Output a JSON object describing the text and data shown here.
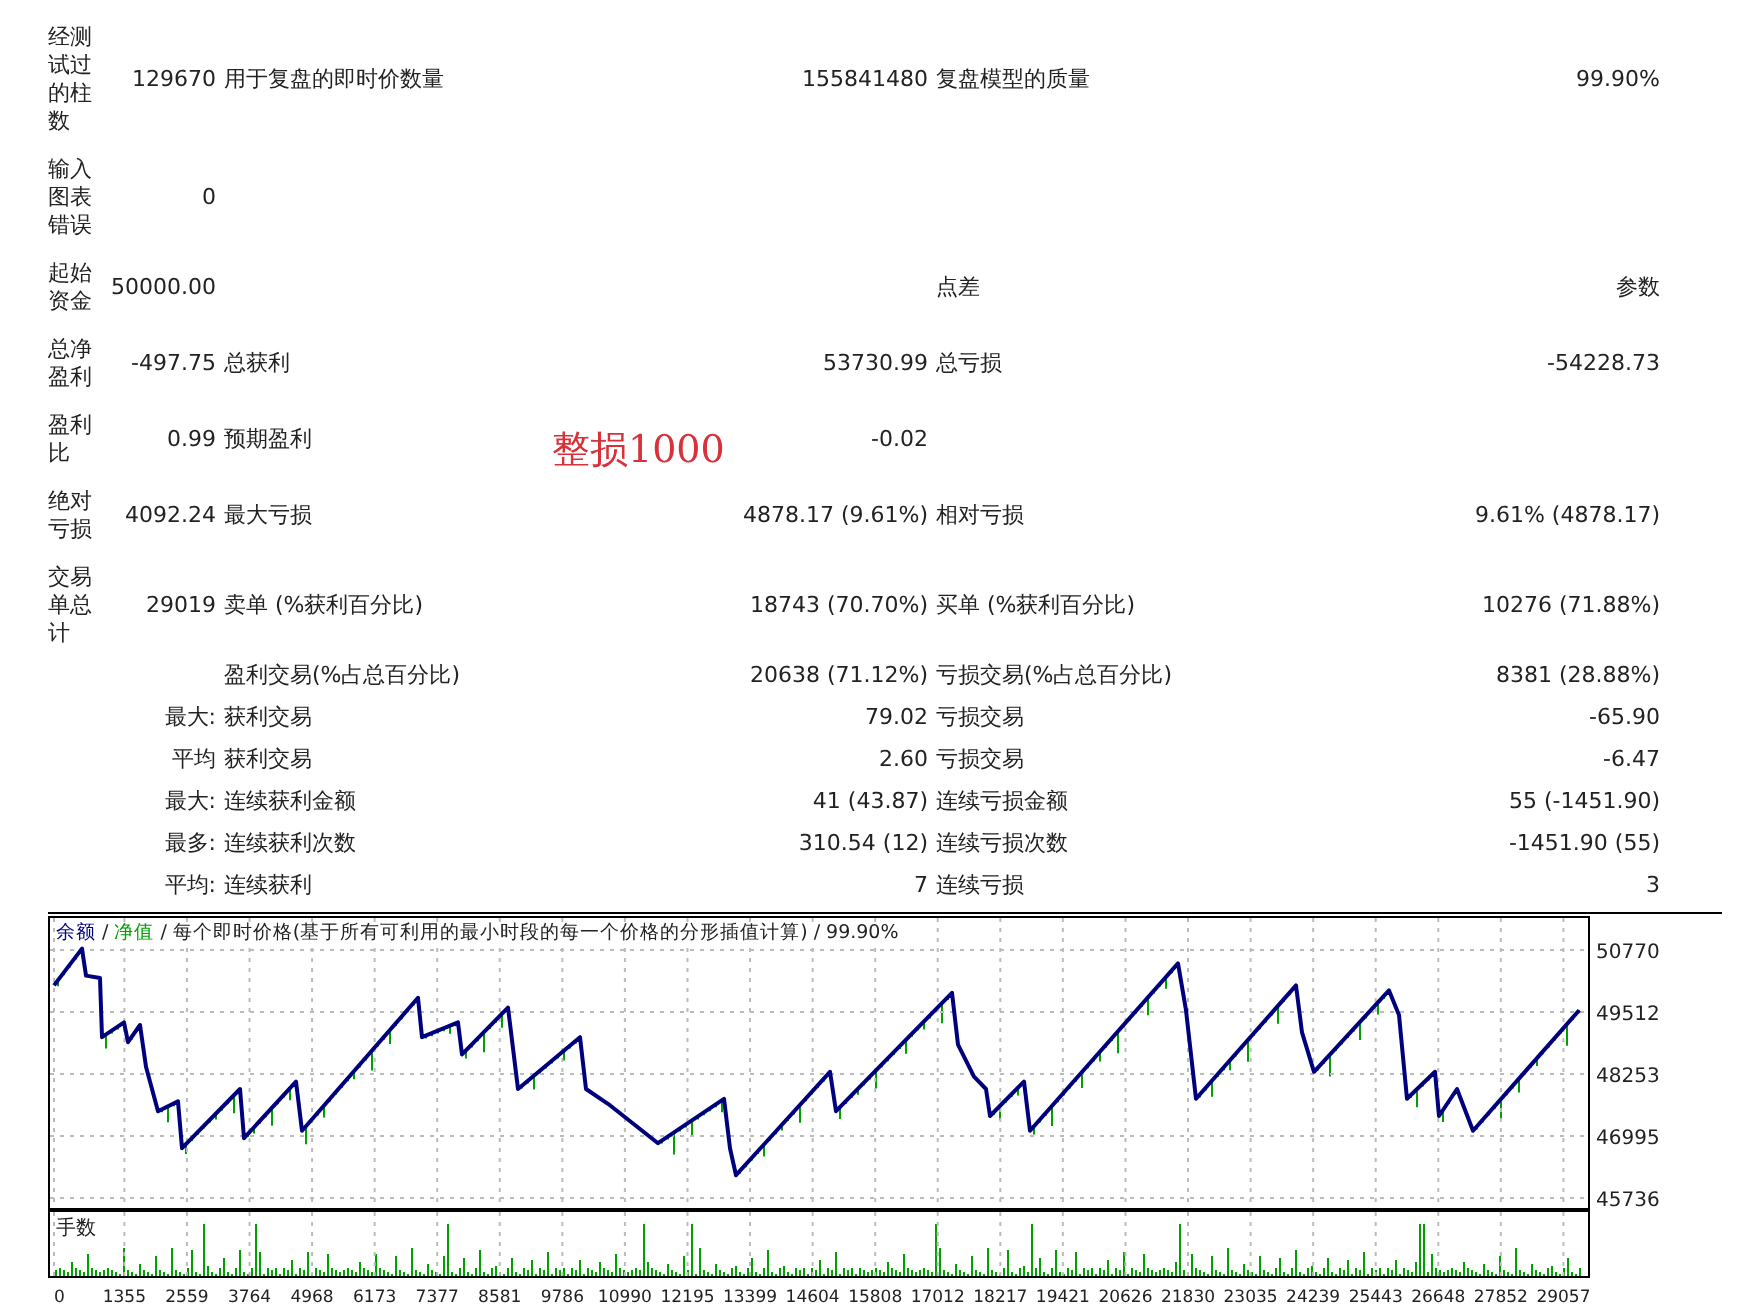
{
  "summary_rows": [
    {
      "label": "经测试过的柱数",
      "value": "129670",
      "label_2": "用于复盘的即时价数量",
      "value_2": "155841480",
      "label_3": "复盘模型的质量",
      "value_3": "99.90%"
    },
    {
      "label": "输入图表错误",
      "value": "0"
    },
    {
      "label": "起始资金",
      "value": "50000.00",
      "label_3": "点差",
      "value_3": "参数"
    },
    {
      "label": "总净盈利",
      "value": "-497.75",
      "label_2": "总获利",
      "value_2": "53730.99",
      "label_3": "总亏损",
      "value_3": "-54228.73"
    },
    {
      "label": "盈利比",
      "value": "0.99",
      "label_2": "预期盈利",
      "value_2": "-0.02"
    },
    {
      "label": "绝对亏损",
      "value": "4092.24",
      "label_2": "最大亏损",
      "value_2": "4878.17 (9.61%)",
      "label_3": "相对亏损",
      "value_3": "9.61% (4878.17)"
    },
    {
      "label": "交易单总计",
      "value": "29019",
      "label_2": "卖单 (%获利百分比)",
      "value_2": "18743 (70.70%)",
      "label_3": "买单 (%获利百分比)",
      "value_3": "10276 (71.88%)"
    }
  ],
  "trade_rows": [
    {
      "label": "盈利交易(%占总百分比)",
      "value": "20638 (71.12%)",
      "label_2": "亏损交易(%占总百分比)",
      "value_2": "8381 (28.88%)"
    },
    {
      "prefix": "最大:",
      "label": "获利交易",
      "value": "79.02",
      "label_2": "亏损交易",
      "value_2": "-65.90"
    },
    {
      "prefix": "平均",
      "label": "获利交易",
      "value": "2.60",
      "label_2": "亏损交易",
      "value_2": "-6.47"
    },
    {
      "prefix": "最大:",
      "label": "连续获利金额",
      "value": "41 (43.87)",
      "label_2": "连续亏损金额",
      "value_2": "55 (-1451.90)"
    },
    {
      "prefix": "最多:",
      "label": "连续获利次数",
      "value": "310.54 (12)",
      "label_2": "连续亏损次数",
      "value_2": "-1451.90 (55)"
    },
    {
      "prefix": "平均:",
      "label": "连续获利",
      "value": "7",
      "label_2": "连续亏损",
      "value_2": "3"
    }
  ],
  "annotation": {
    "text": "整损1000",
    "color": "#d9313a"
  },
  "chart": {
    "legend": [
      {
        "kind": "series_name"
      },
      {
        "kind": "separator",
        "text": "/"
      },
      {
        "kind": "series_label",
        "text": "净值",
        "color": "#00a000"
      },
      {
        "kind": "separator",
        "text": "/"
      },
      {
        "kind": "text",
        "text": "每个即时价格(基于所有可利用的最小时段的每一个价格的分形插值计算)"
      },
      {
        "kind": "separator",
        "text": "/"
      },
      {
        "kind": "text",
        "text": "99.90%"
      }
    ],
    "volume_label": "手数",
    "chart_data": {
      "type": "line",
      "grid": true,
      "x": [
        0,
        539,
        616,
        886,
        924,
        1348,
        1424,
        1656,
        1771,
        2002,
        2387,
        2464,
        3581,
        3658,
        4659,
        4774,
        7007,
        7084,
        7777,
        7854,
        8740,
        8932,
        10126,
        10241,
        10665,
        11627,
        12898,
        13013,
        13129,
        14938,
        15054,
        17288,
        17403,
        17711,
        17942,
        18019,
        18673,
        18789,
        21638,
        21792,
        21984,
        23909,
        24024,
        24255,
        25700,
        25893,
        26047,
        26586,
        26663,
        27010,
        27318,
        29359
      ],
      "series": [
        {
          "name": "余额",
          "color": "#00007f",
          "values": [
            50050,
            50800,
            50250,
            50200,
            49000,
            49300,
            48900,
            49250,
            48400,
            47500,
            47700,
            46750,
            47950,
            46950,
            48100,
            47100,
            49800,
            49000,
            49300,
            48650,
            49600,
            47950,
            49000,
            47950,
            47650,
            46850,
            47750,
            46750,
            46200,
            48300,
            47500,
            49900,
            48850,
            48200,
            47950,
            47400,
            48100,
            47100,
            50500,
            49550,
            47750,
            50050,
            49100,
            48300,
            49950,
            49450,
            47750,
            48300,
            47400,
            47950,
            47100,
            49550
          ]
        }
      ],
      "xlim": [
        0,
        29530
      ],
      "ylim": [
        45535,
        51460
      ],
      "xticks": [
        0,
        1355,
        2559,
        3764,
        4968,
        6173,
        7377,
        8581,
        9786,
        10990,
        12195,
        13399,
        14604,
        15808,
        17012,
        18217,
        19421,
        20626,
        21830,
        23035,
        24239,
        25443,
        26648,
        27852,
        29057
      ],
      "yticks": [
        45736,
        46995,
        48253,
        49512,
        50770
      ]
    }
  }
}
